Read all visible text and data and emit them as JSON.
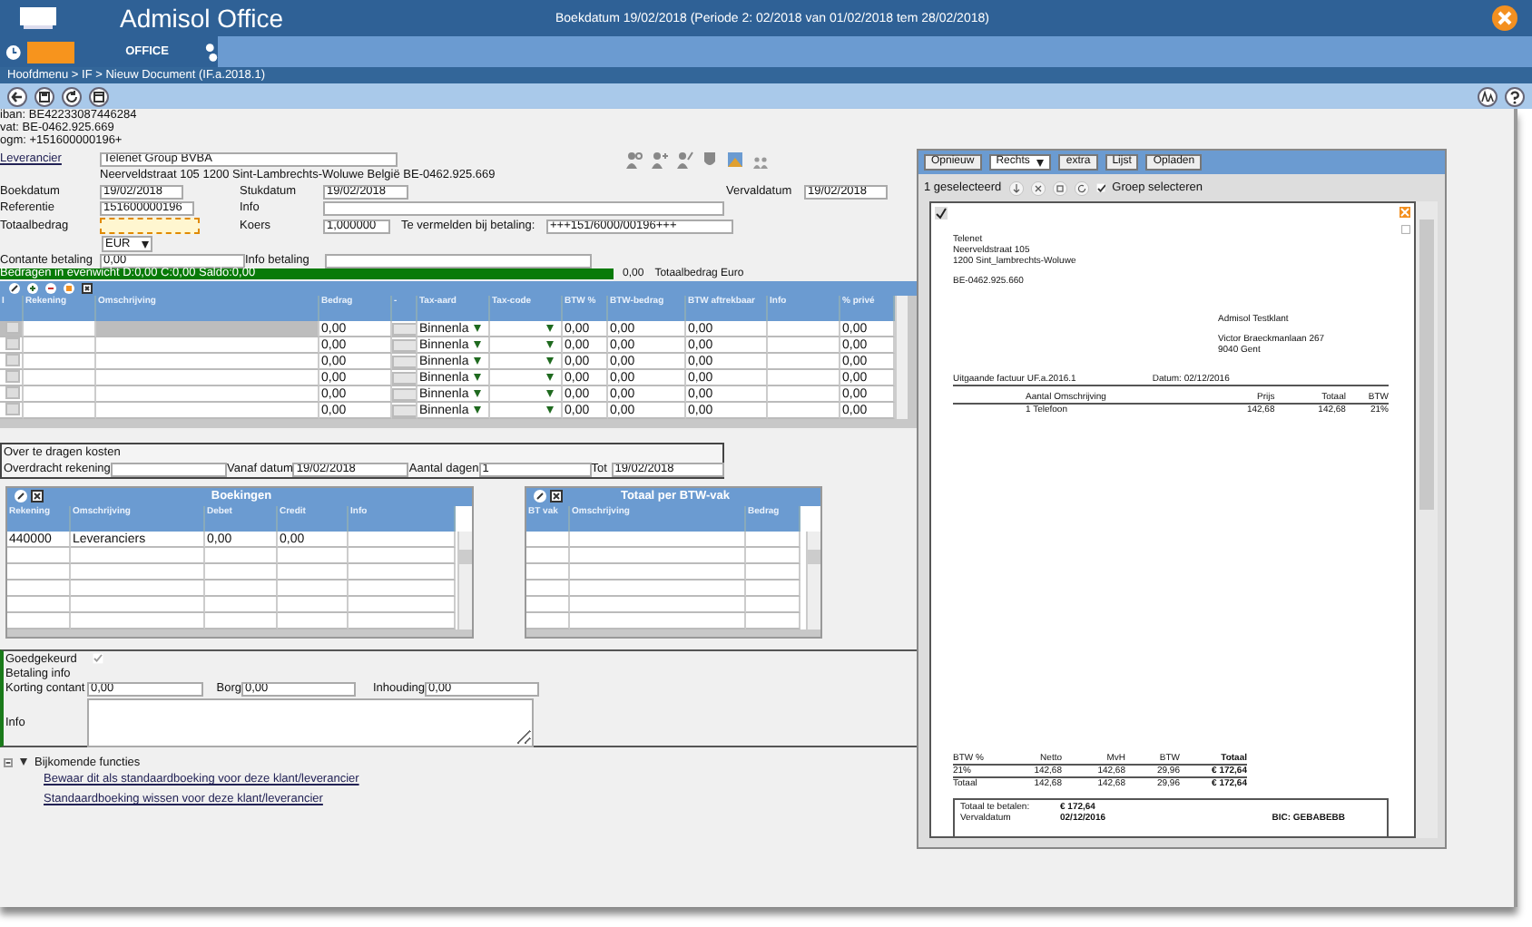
{
  "app": {
    "title": "Admisol Office",
    "period": "Boekdatum 19/02/2018 (Periode 2: 02/2018 van 01/02/2018 tem 28/02/2018)",
    "module": "OFFICE",
    "breadcrumb": "Hoofdmenu > IF > Nieuw Document (IF.a.2018.1)"
  },
  "header_lines": [
    "iban: BE42233087446284",
    "vat: BE-0462.925.669",
    "ogm: +151600000196+"
  ],
  "supplier": {
    "label": "Leverancier",
    "value": "Telenet Group BVBA",
    "address": "Neerveldstraat 105 1200 Sint-Lambrechts-Woluwe België BE-0462.925.669"
  },
  "fields": {
    "boekdatum": {
      "label": "Boekdatum",
      "value": "19/02/2018"
    },
    "stukdatum": {
      "label": "Stukdatum",
      "value": "19/02/2018"
    },
    "vervaldatum": {
      "label": "Vervaldatum",
      "value": "19/02/2018"
    },
    "referentie": {
      "label": "Referentie",
      "value": "151600000196"
    },
    "info": {
      "label": "Info"
    },
    "totaalbedrag": {
      "label": "Totaalbedrag",
      "highlighted": true
    },
    "koers": {
      "label": "Koers",
      "value": "1,000000"
    },
    "te_vermelden": {
      "label": "Te vermelden bij betaling:",
      "value": "+++151/6000/00196+++"
    },
    "currency": "EUR",
    "contante": {
      "label": "Contante betaling",
      "value": "0,00"
    },
    "info_betaling": {
      "label": "Info betaling"
    }
  },
  "balance": {
    "text": "Bedragen in evenwicht D:0,00 C:0,00 Saldo:0,00",
    "amount": "0,00",
    "label": "Totaalbedrag Euro"
  },
  "lines": {
    "columns": [
      "I",
      "Rekening",
      "Omschrijving",
      "Bedrag",
      "-",
      "Tax-aard",
      "Tax-code",
      "BTW %",
      "BTW-bedrag",
      "BTW aftrekbaar",
      "Info",
      "% privé"
    ],
    "rows": [
      {
        "selected": true,
        "bedrag": "0,00",
        "tax_aard": "Binnenla",
        "btw_pct": "0,00",
        "btw_bedrag": "0,00",
        "btw_aftrekbaar": "0,00",
        "prive": "0,00"
      },
      {
        "selected": false,
        "bedrag": "0,00",
        "tax_aard": "Binnenla",
        "btw_pct": "0,00",
        "btw_bedrag": "0,00",
        "btw_aftrekbaar": "0,00",
        "prive": "0,00"
      },
      {
        "selected": false,
        "bedrag": "0,00",
        "tax_aard": "Binnenla",
        "btw_pct": "0,00",
        "btw_bedrag": "0,00",
        "btw_aftrekbaar": "0,00",
        "prive": "0,00"
      },
      {
        "selected": false,
        "bedrag": "0,00",
        "tax_aard": "Binnenla",
        "btw_pct": "0,00",
        "btw_bedrag": "0,00",
        "btw_aftrekbaar": "0,00",
        "prive": "0,00"
      },
      {
        "selected": false,
        "bedrag": "0,00",
        "tax_aard": "Binnenla",
        "btw_pct": "0,00",
        "btw_bedrag": "0,00",
        "btw_aftrekbaar": "0,00",
        "prive": "0,00"
      },
      {
        "selected": false,
        "bedrag": "0,00",
        "tax_aard": "Binnenla",
        "btw_pct": "0,00",
        "btw_bedrag": "0,00",
        "btw_aftrekbaar": "0,00",
        "prive": "0,00"
      }
    ]
  },
  "transfer": {
    "title": "Over te dragen kosten",
    "rekening_label": "Overdracht rekening",
    "vanaf_label": "Vanaf datum",
    "vanaf": "19/02/2018",
    "dagen_label": "Aantal dagen",
    "dagen": "1",
    "tot_label": "Tot",
    "tot": "19/02/2018"
  },
  "bookings": {
    "title": "Boekingen",
    "columns": [
      "Rekening",
      "Omschrijving",
      "Debet",
      "Credit",
      "Info"
    ],
    "rows": [
      [
        "440000",
        "Leveranciers",
        "0,00",
        "0,00",
        ""
      ]
    ]
  },
  "vat_totals": {
    "title": "Totaal per BTW-vak",
    "columns": [
      "BT vak",
      "Omschrijving",
      "Bedrag"
    ]
  },
  "approval": {
    "label": "Goedgekeurd",
    "checked": true,
    "payment_title": "Betaling info",
    "korting_label": "Korting contant",
    "korting": "0,00",
    "borg_label": "Borg",
    "borg": "0,00",
    "inhouding_label": "Inhouding",
    "inhouding": "0,00",
    "info_label": "Info"
  },
  "extra": {
    "label": "Bijkomende functies",
    "expanded": true,
    "links": [
      "Bewaar dit als standaardboeking voor deze klant/leverancier",
      "Standaardboeking wissen voor deze klant/leverancier"
    ]
  },
  "preview": {
    "buttons": [
      {
        "label": "Opnieuw",
        "kind": "button"
      },
      {
        "label": "Rechts",
        "kind": "dropdown"
      },
      {
        "label": "extra",
        "kind": "button"
      },
      {
        "label": "Lijst",
        "kind": "button"
      },
      {
        "label": "Opladen",
        "kind": "button"
      }
    ],
    "selection": "1 geselecteerd",
    "group_select": {
      "label": "Groep selecteren",
      "checked": true
    },
    "document": {
      "sender": [
        "Telenet",
        "Neerveldstraat 105",
        "1200 Sint_lambrechts-Woluwe"
      ],
      "sender_vat": "BE-0462.925.660",
      "recipient": "Admisol Testklant",
      "recipient_address": [
        "Victor Braeckmanlaan 267",
        "9040 Gent"
      ],
      "invoice_title": "Uitgaande factuur UF.a.2016.1",
      "invoice_date": "Datum: 02/12/2016",
      "item_columns": [
        "Aantal Omschrijving",
        "Prijs",
        "Totaal",
        "BTW"
      ],
      "items": [
        [
          "1 Telefoon",
          "142,68",
          "142,68",
          "21%"
        ]
      ],
      "vat_columns": [
        "BTW %",
        "Netto",
        "MvH",
        "BTW",
        "Totaal"
      ],
      "vat_rows": [
        [
          "21%",
          "142,68",
          "142,68",
          "29,96",
          "€ 172,64"
        ],
        [
          "Totaal",
          "142,68",
          "142,68",
          "29,96",
          "€ 172,64"
        ]
      ],
      "payment": [
        [
          "Totaal te betalen:",
          "€ 172,64"
        ],
        [
          "Vervaldatum",
          "02/12/2016"
        ]
      ],
      "bic": "BIC: GEBABEBB"
    }
  }
}
